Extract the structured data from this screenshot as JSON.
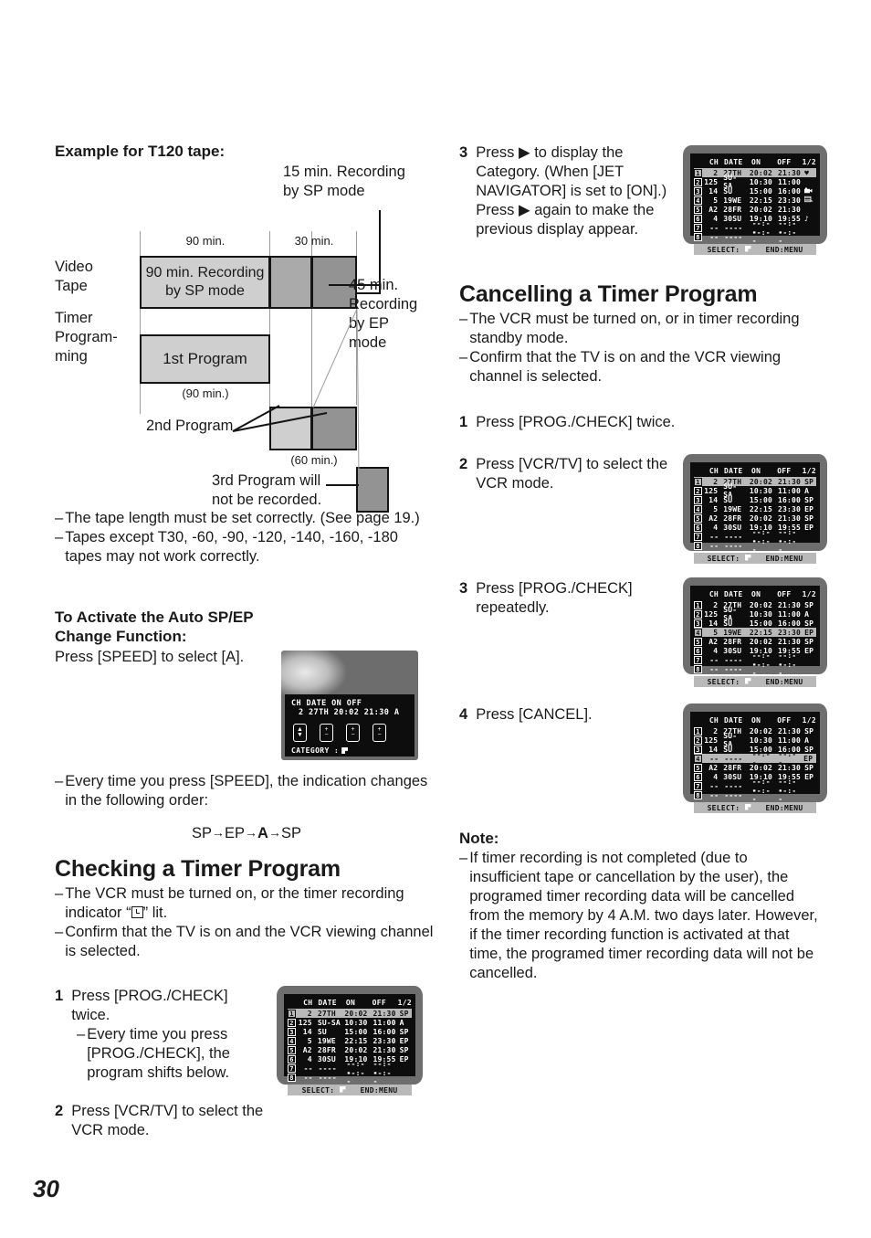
{
  "page_number": "30",
  "left": {
    "example_heading": "Example for T120 tape:",
    "diagram": {
      "callout_15min": "15 min. Recording\nby SP mode",
      "tick_90": "90 min.",
      "tick_30": "30 min.",
      "row_label_tape": "Video\nTape",
      "row_label_timer": "Timer\nProgram-\nming",
      "tape_block": "90 min. Recording\nby SP mode",
      "callout_45min": "45 min.\nRecording\nby EP\nmode",
      "prog1": "1st Program",
      "prog1_dur": "(90 min.)",
      "prog2": "2nd Program",
      "prog2_dur": "(60 min.)",
      "prog3": "3rd Program will\nnot be recorded."
    },
    "notes": [
      "The tape length must be set correctly. (See page 19.)",
      "Tapes except T30, -60, -90, -120, -140, -160, -180 tapes may not work correctly."
    ],
    "auto_heading": "To Activate the Auto SP/EP Change Function:",
    "auto_line": "Press [SPEED] to select [A].",
    "speed_note": "Every time you press [SPEED], the indication changes in the following order:",
    "speed_order": "SP→EP→A→SP",
    "speed_order_parts": {
      "a": "SP",
      "b": "EP",
      "c": "A",
      "d": "SP"
    },
    "checking": {
      "heading": "Checking a Timer Program",
      "bullets_pre": "The VCR must be turned on, or the timer recording indicator “",
      "bullets_post": "” lit.",
      "bullet2": "Confirm that the TV is on and the VCR viewing channel is selected.",
      "step1_num": "1",
      "step1": "Press [PROG./CHECK] twice.",
      "step1_sub": "Every time you press [PROG./CHECK], the program shifts below.",
      "step2_num": "2",
      "step2": "Press [VCR/TV] to select the VCR mode."
    },
    "category_tv": {
      "head": "CH  DATE  ON     OFF",
      "values": "2  27TH  20:02  21:30  A",
      "footer_label": "CATEGORY :",
      "buttons": [
        "up-down",
        "plus-minus",
        "plus-minus",
        "plus-minus"
      ]
    }
  },
  "right": {
    "step3_num": "3",
    "step3": "Press ▶ to display the Category. (When [JET NAVIGATOR] is set to [ON].) Press ▶ again to make the previous display appear.",
    "cancel_heading": "Cancelling a Timer Program",
    "cancel_bullets": [
      "The VCR must be turned on, or in timer recording standby mode.",
      "Confirm that the TV is on and the VCR viewing channel is selected."
    ],
    "steps": [
      {
        "num": "1",
        "text": "Press [PROG./CHECK] twice."
      },
      {
        "num": "2",
        "text": "Press [VCR/TV] to select the VCR mode."
      },
      {
        "num": "3",
        "text": "Press [PROG./CHECK] repeatedly."
      },
      {
        "num": "4",
        "text": "Press [CANCEL]."
      }
    ],
    "note_heading": "Note:",
    "note_body": "If timer recording is not completed (due to insufficient tape or cancellation by the user), the programed timer recording data will be cancelled from the memory by 4 A.M. two days later. However, if the timer recording function is activated at that time, the programed timer recording data will not be cancelled."
  },
  "osd": {
    "columns": [
      "CH",
      "DATE",
      "ON",
      "OFF",
      "1/2"
    ],
    "footer": {
      "select": "SELECT:",
      "end": "END:MENU"
    },
    "screens": [
      {
        "id": "osd-category",
        "highlight_row": 1,
        "last_col_mode": "icons",
        "rows": [
          {
            "idx": "1",
            "ch": "2",
            "date": "27TH",
            "on": "20:02",
            "off": "21:30",
            "last": "♥"
          },
          {
            "idx": "2",
            "ch": "125",
            "date": "SU-SA",
            "on": "10:30",
            "off": "11:00",
            "last": ""
          },
          {
            "idx": "3",
            "ch": "14",
            "date": "SU",
            "on": "15:00",
            "off": "16:00",
            "last": "camera-icon"
          },
          {
            "idx": "4",
            "ch": "5",
            "date": "19WE",
            "on": "22:15",
            "off": "23:30",
            "last": "film-icon"
          },
          {
            "idx": "5",
            "ch": "A2",
            "date": "28FR",
            "on": "20:02",
            "off": "21:30",
            "last": ""
          },
          {
            "idx": "6",
            "ch": "4",
            "date": "30SU",
            "on": "19:10",
            "off": "19:55",
            "last": "♪"
          },
          {
            "idx": "7",
            "ch": "--",
            "date": "----",
            "on": "--:--",
            "off": "--:--",
            "last": ""
          },
          {
            "idx": "8",
            "ch": "--",
            "date": "----",
            "on": "--:--",
            "off": "--:--",
            "last": ""
          }
        ]
      },
      {
        "id": "osd-check-left",
        "highlight_row": 1,
        "last_col_mode": "text",
        "rows": [
          {
            "idx": "1",
            "ch": "2",
            "date": "27TH",
            "on": "20:02",
            "off": "21:30",
            "last": "SP"
          },
          {
            "idx": "2",
            "ch": "125",
            "date": "SU-SA",
            "on": "10:30",
            "off": "11:00",
            "last": "A"
          },
          {
            "idx": "3",
            "ch": "14",
            "date": "SU",
            "on": "15:00",
            "off": "16:00",
            "last": "SP"
          },
          {
            "idx": "4",
            "ch": "5",
            "date": "19WE",
            "on": "22:15",
            "off": "23:30",
            "last": "EP"
          },
          {
            "idx": "5",
            "ch": "A2",
            "date": "28FR",
            "on": "20:02",
            "off": "21:30",
            "last": "SP"
          },
          {
            "idx": "6",
            "ch": "4",
            "date": "30SU",
            "on": "19:10",
            "off": "19:55",
            "last": "EP"
          },
          {
            "idx": "7",
            "ch": "--",
            "date": "----",
            "on": "--:--",
            "off": "--:--",
            "last": ""
          },
          {
            "idx": "8",
            "ch": "--",
            "date": "----",
            "on": "--:--",
            "off": "--:--",
            "last": ""
          }
        ]
      },
      {
        "id": "osd-cancel-step2",
        "highlight_row": 1,
        "last_col_mode": "text",
        "rows": [
          {
            "idx": "1",
            "ch": "2",
            "date": "27TH",
            "on": "20:02",
            "off": "21:30",
            "last": "SP"
          },
          {
            "idx": "2",
            "ch": "125",
            "date": "SU-SA",
            "on": "10:30",
            "off": "11:00",
            "last": "A"
          },
          {
            "idx": "3",
            "ch": "14",
            "date": "SU",
            "on": "15:00",
            "off": "16:00",
            "last": "SP"
          },
          {
            "idx": "4",
            "ch": "5",
            "date": "19WE",
            "on": "22:15",
            "off": "23:30",
            "last": "EP"
          },
          {
            "idx": "5",
            "ch": "A2",
            "date": "28FR",
            "on": "20:02",
            "off": "21:30",
            "last": "SP"
          },
          {
            "idx": "6",
            "ch": "4",
            "date": "30SU",
            "on": "19:10",
            "off": "19:55",
            "last": "EP"
          },
          {
            "idx": "7",
            "ch": "--",
            "date": "----",
            "on": "--:--",
            "off": "--:--",
            "last": ""
          },
          {
            "idx": "8",
            "ch": "--",
            "date": "----",
            "on": "--:--",
            "off": "--:--",
            "last": ""
          }
        ]
      },
      {
        "id": "osd-cancel-step3",
        "highlight_row": 4,
        "last_col_mode": "text",
        "rows": [
          {
            "idx": "1",
            "ch": "2",
            "date": "27TH",
            "on": "20:02",
            "off": "21:30",
            "last": "SP"
          },
          {
            "idx": "2",
            "ch": "125",
            "date": "SU-SA",
            "on": "10:30",
            "off": "11:00",
            "last": "A"
          },
          {
            "idx": "3",
            "ch": "14",
            "date": "SU",
            "on": "15:00",
            "off": "16:00",
            "last": "SP"
          },
          {
            "idx": "4",
            "ch": "5",
            "date": "19WE",
            "on": "22:15",
            "off": "23:30",
            "last": "EP"
          },
          {
            "idx": "5",
            "ch": "A2",
            "date": "28FR",
            "on": "20:02",
            "off": "21:30",
            "last": "SP"
          },
          {
            "idx": "6",
            "ch": "4",
            "date": "30SU",
            "on": "19:10",
            "off": "19:55",
            "last": "EP"
          },
          {
            "idx": "7",
            "ch": "--",
            "date": "----",
            "on": "--:--",
            "off": "--:--",
            "last": ""
          },
          {
            "idx": "8",
            "ch": "--",
            "date": "----",
            "on": "--:--",
            "off": "--:--",
            "last": ""
          }
        ]
      },
      {
        "id": "osd-cancel-step4",
        "highlight_row": 4,
        "last_col_mode": "text",
        "rows": [
          {
            "idx": "1",
            "ch": "2",
            "date": "27TH",
            "on": "20:02",
            "off": "21:30",
            "last": "SP"
          },
          {
            "idx": "2",
            "ch": "125",
            "date": "SU-SA",
            "on": "10:30",
            "off": "11:00",
            "last": "A"
          },
          {
            "idx": "3",
            "ch": "14",
            "date": "SU",
            "on": "15:00",
            "off": "16:00",
            "last": "SP"
          },
          {
            "idx": "4",
            "ch": "--",
            "date": "----",
            "on": "--:--",
            "off": "--:--",
            "last": "EP"
          },
          {
            "idx": "5",
            "ch": "A2",
            "date": "28FR",
            "on": "20:02",
            "off": "21:30",
            "last": "SP"
          },
          {
            "idx": "6",
            "ch": "4",
            "date": "30SU",
            "on": "19:10",
            "off": "19:55",
            "last": "EP"
          },
          {
            "idx": "7",
            "ch": "--",
            "date": "----",
            "on": "--:--",
            "off": "--:--",
            "last": ""
          },
          {
            "idx": "8",
            "ch": "--",
            "date": "----",
            "on": "--:--",
            "off": "--:--",
            "last": ""
          }
        ]
      }
    ]
  }
}
